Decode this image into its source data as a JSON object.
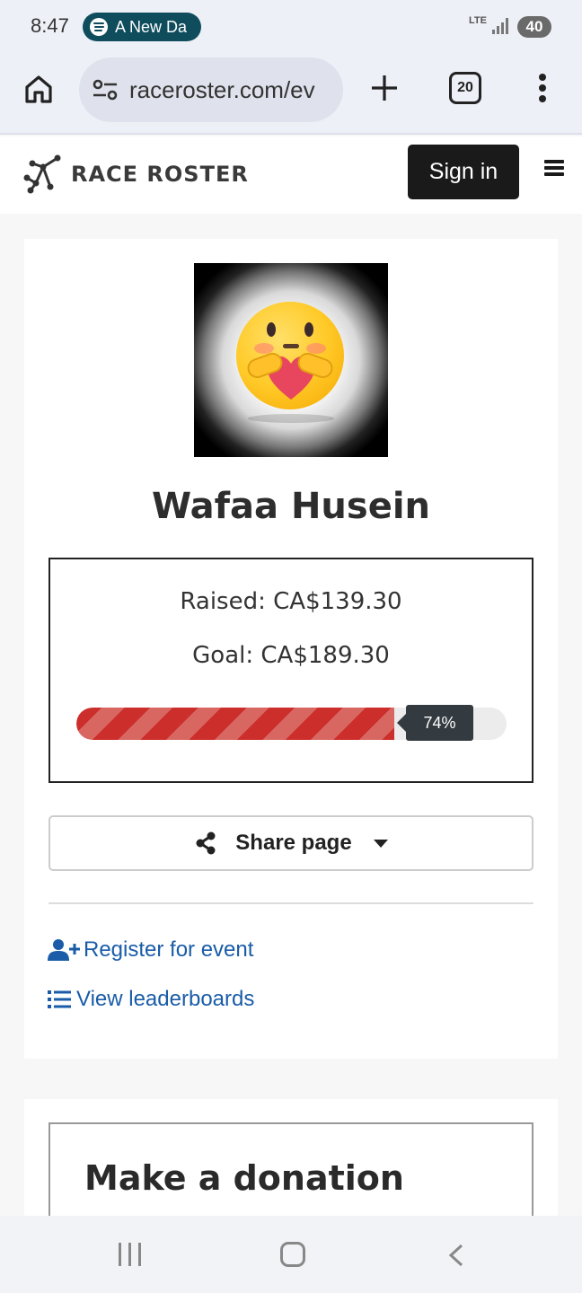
{
  "status_bar": {
    "time": "8:47",
    "media_pill_text": "A New Da",
    "network": "LTE",
    "battery": "40"
  },
  "browser": {
    "url": "raceroster.com/ev",
    "tab_count": "20"
  },
  "header": {
    "brand": "RACE ROSTER",
    "sign_in_label": "Sign in"
  },
  "profile": {
    "name": "Wafaa Husein"
  },
  "fundraising": {
    "raised_text": "Raised: CA$139.30",
    "goal_text": "Goal: CA$189.30",
    "progress_label": "74%",
    "progress_fraction": 0.74,
    "bar_color": "#cc2e2b"
  },
  "actions": {
    "share_label": "Share page",
    "register_label": "Register for event",
    "leaderboards_label": "View leaderboards",
    "link_color": "#1a5ca8"
  },
  "donation": {
    "title": "Make a donation"
  }
}
